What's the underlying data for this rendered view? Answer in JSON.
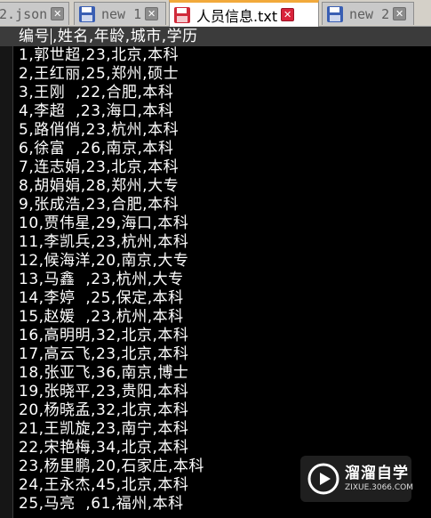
{
  "tabs": [
    {
      "label": "2.json",
      "icon": "json-file-icon",
      "close": "close-icon",
      "active": false
    },
    {
      "label": "new 1",
      "icon": "floppy-disk-icon",
      "close": "close-icon",
      "active": false
    },
    {
      "label": "人员信息.txt",
      "icon": "floppy-disk-red-icon",
      "close": "close-icon",
      "active": true
    },
    {
      "label": "new 2",
      "icon": "floppy-disk-icon",
      "close": "close-icon",
      "active": false
    }
  ],
  "editor": {
    "header_before_caret": "编号",
    "header_after_caret": ",姓名,年龄,城市,学历",
    "lines": [
      "1,郭世超,23,北京,本科",
      "2,王红丽,25,郑州,硕士",
      "3,王刚  ,22,合肥,本科",
      "4,李超  ,23,海口,本科",
      "5,路俏俏,23,杭州,本科",
      "6,徐富  ,26,南京,本科",
      "7,连志娟,23,北京,本科",
      "8,胡娟娟,28,郑州,大专",
      "9,张成浩,23,合肥,本科",
      "10,贾伟星,29,海口,本科",
      "11,李凯兵,23,杭州,本科",
      "12,候海洋,20,南京,大专",
      "13,马鑫  ,23,杭州,大专",
      "14,李婷  ,25,保定,本科",
      "15,赵媛  ,23,杭州,本科",
      "16,高明明,32,北京,本科",
      "17,高云飞,23,北京,本科",
      "18,张亚飞,36,南京,博士",
      "19,张晓平,23,贵阳,本科",
      "20,杨晓孟,32,北京,本科",
      "21,王凯旋,23,南宁,本科",
      "22,宋艳梅,34,北京,本科",
      "23,杨里鹏,20,石家庄,本科",
      "24,王永杰,45,北京,本科",
      "25,马亮  ,61,福州,本科"
    ]
  },
  "watermark": {
    "title": "溜溜自学",
    "url": "ZIXUE.3066.COM",
    "icon": "play-logo-icon"
  },
  "colors": {
    "active_tab_accent": "#f2a93b",
    "close_active": "#d9233b",
    "close_inactive": "#8c8c8c",
    "editor_bg": "#000000",
    "editor_text": "#ffffff",
    "current_line_bg": "#3b3b3b"
  }
}
